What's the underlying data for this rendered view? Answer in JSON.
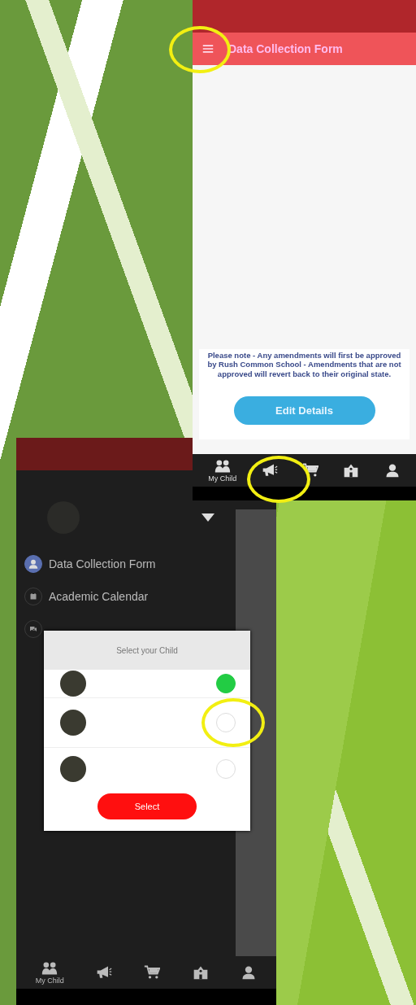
{
  "form_screen": {
    "title": "Data Collection Form",
    "note": "Please note - Any amendments will first be approved by Rush Common School - Amendments that are not approved will revert back to their original state.",
    "button": "Edit Details",
    "nav": [
      {
        "kind": "children",
        "label": "My Child"
      },
      {
        "kind": "megaphone"
      },
      {
        "kind": "cart"
      },
      {
        "kind": "school"
      },
      {
        "kind": "person"
      }
    ]
  },
  "drawer_screen": {
    "menu": [
      {
        "kind": "person",
        "label": "Data Collection Form",
        "selected": true
      },
      {
        "kind": "calendar",
        "label": "Academic Calendar",
        "selected": false
      },
      {
        "kind": "chat",
        "selected": false
      }
    ],
    "dialog": {
      "title": "Select your Child",
      "children": [
        {
          "selected": true
        },
        {
          "selected": false
        },
        {
          "selected": false
        }
      ],
      "button": "Select"
    },
    "nav": [
      {
        "kind": "children",
        "label": "My Child"
      },
      {
        "kind": "megaphone"
      },
      {
        "kind": "cart"
      },
      {
        "kind": "school"
      },
      {
        "kind": "person"
      }
    ]
  }
}
